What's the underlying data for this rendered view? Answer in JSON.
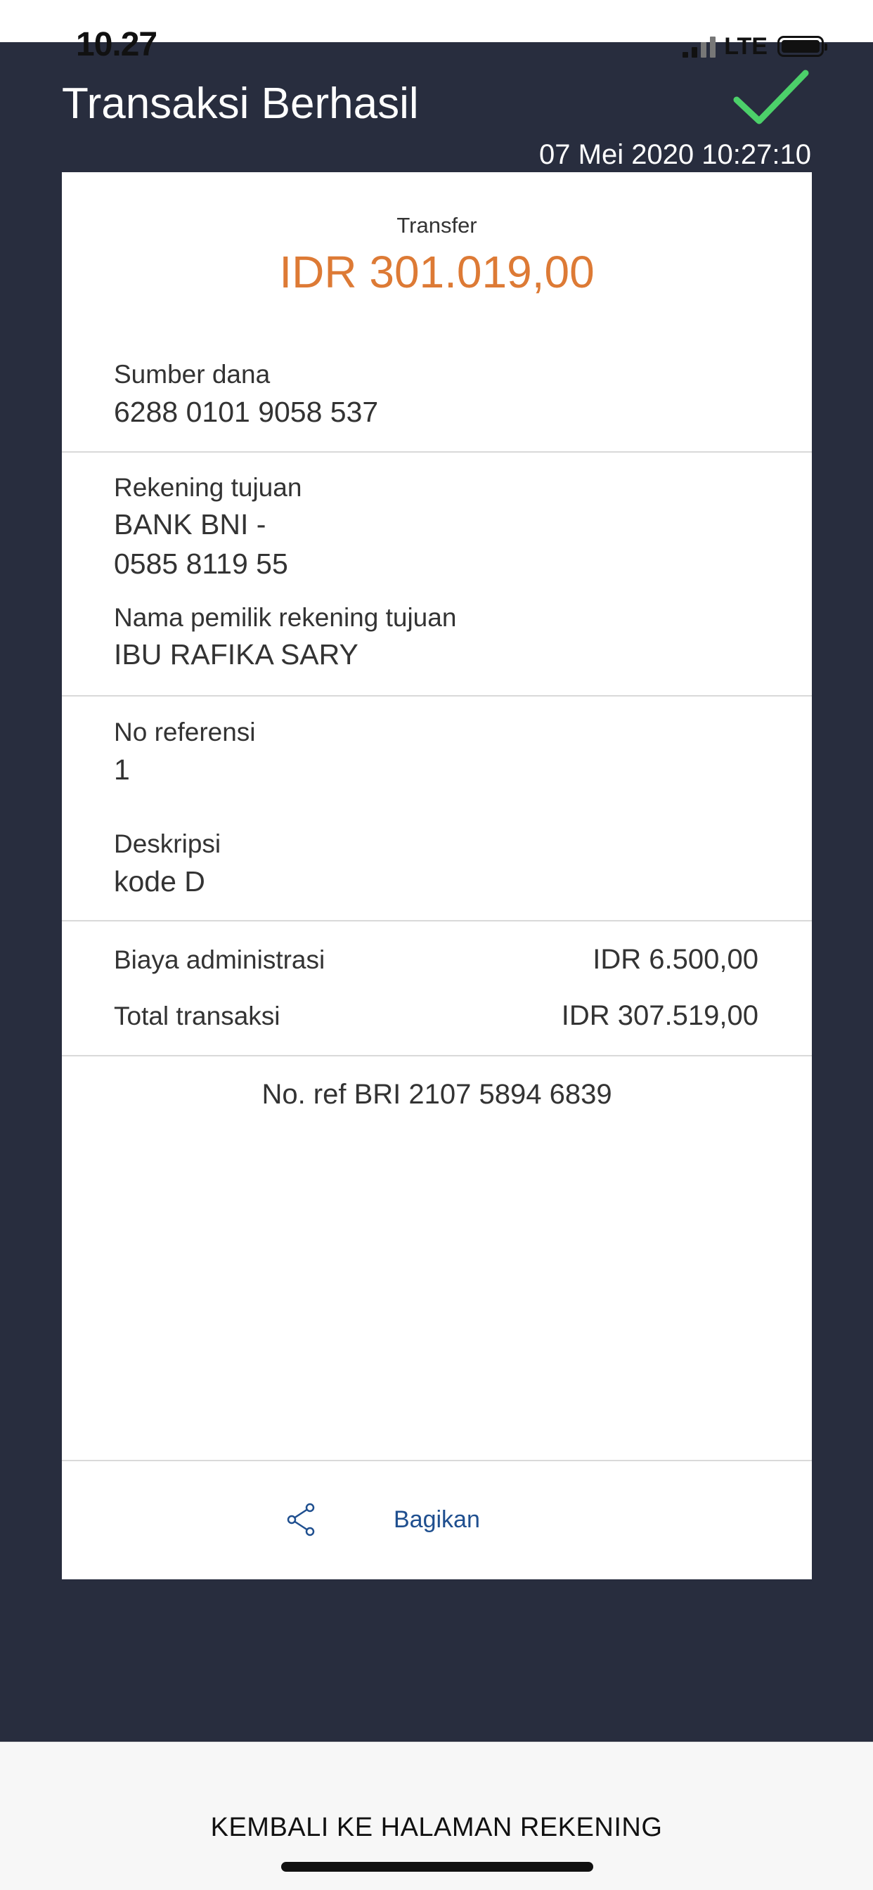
{
  "status_bar": {
    "time": "10.27",
    "network": "LTE"
  },
  "header": {
    "title": "Transaksi Berhasil",
    "datetime": "07 Mei 2020 10:27:10",
    "success_icon": "checkmark-icon",
    "success_color": "#4cd06a"
  },
  "receipt": {
    "transfer_type": "Transfer",
    "amount": "IDR 301.019,00",
    "amount_color": "#dd7a35",
    "source_label": "Sumber dana",
    "source_value": "6288 0101 9058 537",
    "dest_label": "Rekening tujuan",
    "dest_bank": "BANK BNI -",
    "dest_account": "0585 8119 55",
    "owner_label": "Nama pemilik rekening tujuan",
    "owner_value": "IBU RAFIKA  SARY",
    "reference_label": "No referensi",
    "reference_value": "1",
    "description_label": "Deskripsi",
    "description_value": "kode D",
    "admin_fee_label": "Biaya administrasi",
    "admin_fee_value": "IDR 6.500,00",
    "total_label": "Total transaksi",
    "total_value": "IDR 307.519,00",
    "bri_ref": "No. ref BRI 2107 5894 6839",
    "share_label": "Bagikan",
    "share_icon": "share-icon"
  },
  "footer": {
    "back_button": "KEMBALI KE HALAMAN REKENING"
  },
  "colors": {
    "background_dark": "#282d3e",
    "link_blue": "#1f4f8f"
  }
}
